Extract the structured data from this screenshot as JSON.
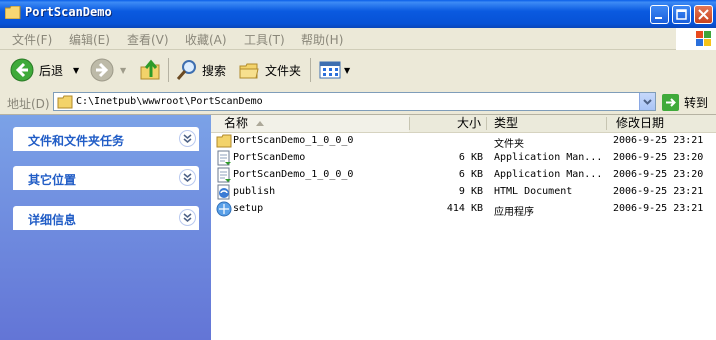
{
  "window": {
    "title": "PortScanDemo",
    "buttons": [
      "minimize",
      "maximize",
      "close"
    ]
  },
  "menu": [
    "文件(F)",
    "编辑(E)",
    "查看(V)",
    "收藏(A)",
    "工具(T)",
    "帮助(H)"
  ],
  "toolbar": {
    "back_label": "后退",
    "search_label": "搜索",
    "folders_label": "文件夹"
  },
  "address": {
    "label": "地址(D)",
    "value": "C:\\Inetpub\\wwwroot\\PortScanDemo",
    "go_label": "转到"
  },
  "tasks": [
    {
      "label": "文件和文件夹任务"
    },
    {
      "label": "其它位置"
    },
    {
      "label": "详细信息"
    }
  ],
  "columns": {
    "name": "名称",
    "size": "大小",
    "type": "类型",
    "modified": "修改日期"
  },
  "files": [
    {
      "icon": "folder-icon",
      "name": "PortScanDemo_1_0_0_0",
      "size": "",
      "type": "文件夹",
      "modified": "2006-9-25 23:21"
    },
    {
      "icon": "manifest-icon",
      "name": "PortScanDemo",
      "size": "6 KB",
      "type": "Application Man...",
      "modified": "2006-9-25 23:20"
    },
    {
      "icon": "manifest-icon",
      "name": "PortScanDemo_1_0_0_0",
      "size": "6 KB",
      "type": "Application Man...",
      "modified": "2006-9-25 23:20"
    },
    {
      "icon": "html-document-icon",
      "name": "publish",
      "size": "9 KB",
      "type": "HTML Document",
      "modified": "2006-9-25 23:21"
    },
    {
      "icon": "application-icon",
      "name": "setup",
      "size": "414 KB",
      "type": "应用程序",
      "modified": "2006-9-25 23:21"
    }
  ],
  "colors": {
    "title_bar": "#0A5AE0",
    "task_pane": "#6F8CDD",
    "task_header_text": "#215DC6"
  }
}
